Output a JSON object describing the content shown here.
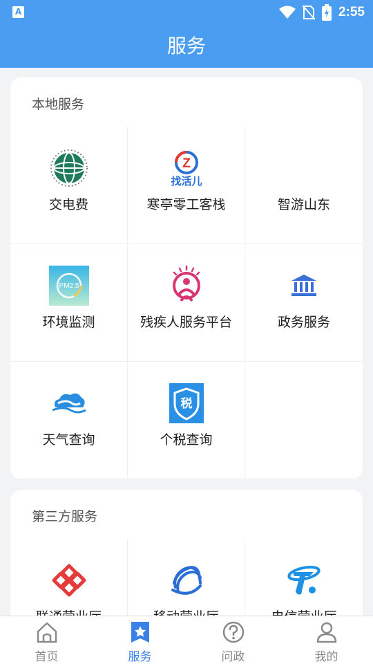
{
  "status_bar": {
    "time": "2:55",
    "left_badge": "A"
  },
  "header": {
    "title": "服务"
  },
  "local_section": {
    "title": "本地服务",
    "items": [
      {
        "label": "交电费",
        "icon": "state-grid-icon"
      },
      {
        "label": "寒亭零工客栈",
        "icon": "zhaohuoer-icon",
        "icon_text": "找活儿",
        "icon_letter": "Z"
      },
      {
        "label": "智游山东",
        "icon": ""
      },
      {
        "label": "环境监测",
        "icon": "pm25-icon",
        "icon_text": "PM2.5"
      },
      {
        "label": "残疾人服务平台",
        "icon": "disabled-service-icon"
      },
      {
        "label": "政务服务",
        "icon": "government-building-icon"
      },
      {
        "label": "天气查询",
        "icon": "weather-cloud-icon"
      },
      {
        "label": "个税查询",
        "icon": "tax-shield-icon",
        "icon_text": "税"
      },
      {
        "label": "",
        "icon": ""
      }
    ]
  },
  "third_section": {
    "title": "第三方服务",
    "items": [
      {
        "label": "联通营业厅",
        "icon": "china-unicom-icon"
      },
      {
        "label": "移动营业厅",
        "icon": "china-mobile-icon"
      },
      {
        "label": "电信营业厅",
        "icon": "china-telecom-icon"
      }
    ]
  },
  "tab_bar": {
    "tabs": [
      {
        "label": "首页",
        "icon": "home-icon",
        "active": false
      },
      {
        "label": "服务",
        "icon": "service-star-icon",
        "active": true
      },
      {
        "label": "问政",
        "icon": "question-icon",
        "active": false
      },
      {
        "label": "我的",
        "icon": "user-icon",
        "active": false
      }
    ]
  },
  "colors": {
    "primary": "#4a9df0",
    "tab_active": "#3b82e6",
    "tab_inactive": "#8a8a8a"
  }
}
